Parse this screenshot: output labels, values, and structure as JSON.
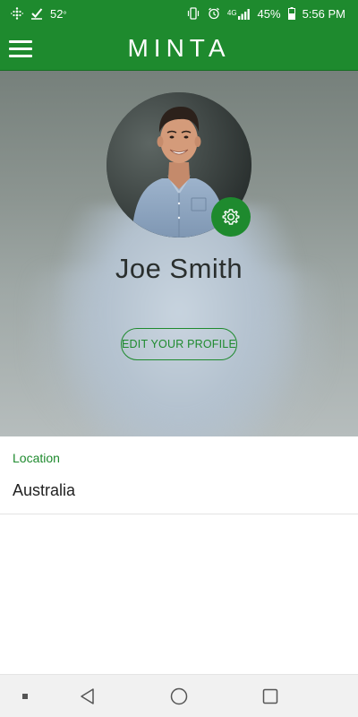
{
  "status_bar": {
    "temperature": "52",
    "temperature_unit": "°",
    "network_label": "4G",
    "battery_percent": "45%",
    "time": "5:56 PM",
    "icons_left": [
      "fitbit-icon",
      "check-icon"
    ],
    "icons_right": [
      "vibrate-icon",
      "alarm-icon",
      "signal-icon",
      "battery-icon"
    ]
  },
  "app_bar": {
    "title": "MINTA",
    "menu_icon": "hamburger-menu-icon",
    "background_color": "#1e8a2e"
  },
  "profile": {
    "name": "Joe Smith",
    "edit_button_label": "EDIT YOUR PROFILE",
    "settings_icon": "gear-icon",
    "accent_color": "#1e8a2e"
  },
  "details": {
    "location_label": "Location",
    "location_value": "Australia"
  },
  "nav_bar": {
    "items": [
      "recent-apps-dot-icon",
      "back-icon",
      "home-icon",
      "overview-icon"
    ]
  }
}
